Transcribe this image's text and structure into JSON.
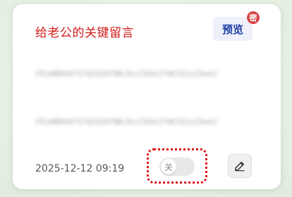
{
  "card": {
    "title": "给老公的关键留言",
    "preview_label": "预览",
    "privacy_badge": "密",
    "blurred_lines": [
      "CR1AB04d7G7Q2U2H7BbJhcZ3Ge1TVK7b1vZ3ee1",
      "CR1AB04d7G7Q2U2H7BbJhcZ3Ge1TVK7b1vZ3ee1"
    ],
    "timestamp": "2025-12-12 09:19",
    "toggle": {
      "state_label": "关",
      "on": false
    },
    "edit_icon": "pencil-icon"
  },
  "colors": {
    "title": "#d01b1b",
    "preview_text": "#1e3da8",
    "badge": "#d64545",
    "highlight": "#e01414"
  }
}
